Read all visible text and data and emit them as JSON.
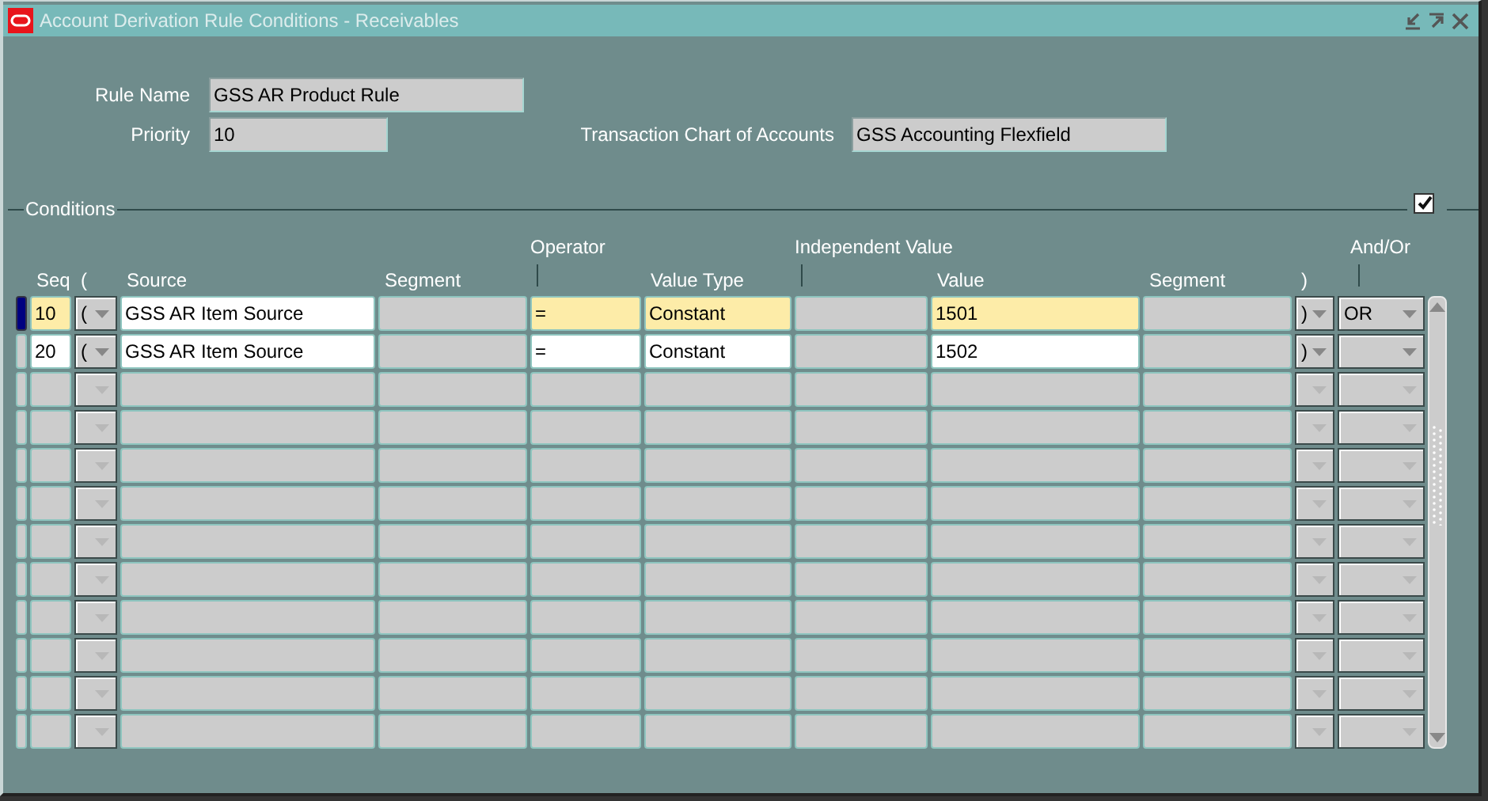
{
  "window": {
    "title": "Account Derivation Rule Conditions - Receivables"
  },
  "header": {
    "rule_name": {
      "label": "Rule Name",
      "value": "GSS AR Product Rule"
    },
    "priority": {
      "label": "Priority",
      "value": "10"
    },
    "chart": {
      "label": "Transaction Chart of Accounts",
      "value": "GSS Accounting Flexfield"
    }
  },
  "conditions": {
    "title": "Conditions",
    "checked": true,
    "group_headers": [
      "Operator",
      "Independent Value",
      "And/Or"
    ],
    "columns": [
      {
        "kind": "text",
        "label": "Seq"
      },
      {
        "kind": "text",
        "label": "("
      },
      {
        "kind": "text",
        "label": "Source"
      },
      {
        "kind": "text",
        "label": "Segment"
      },
      {
        "kind": "mark"
      },
      {
        "kind": "text",
        "label": "Value Type"
      },
      {
        "kind": "mark"
      },
      {
        "kind": "text",
        "label": "Value"
      },
      {
        "kind": "text",
        "label": "Segment"
      },
      {
        "kind": "text",
        "label": ")"
      },
      {
        "kind": "mark"
      }
    ],
    "rows": [
      {
        "kind": "record",
        "selected": true,
        "seq": {
          "value": "10",
          "highlighted": true
        },
        "open_paren": "(",
        "source": {
          "value": "GSS AR Item Source",
          "highlighted": false
        },
        "operator": {
          "value": "=",
          "highlighted": true
        },
        "value_type": {
          "value": "Constant",
          "highlighted": true
        },
        "value": {
          "value": "1501",
          "highlighted": true
        },
        "close_paren": ")",
        "and_or": "OR"
      },
      {
        "kind": "record",
        "selected": false,
        "seq": {
          "value": "20",
          "highlighted": false
        },
        "open_paren": "(",
        "source": {
          "value": "GSS AR Item Source",
          "highlighted": false
        },
        "operator": {
          "value": "=",
          "highlighted": false
        },
        "value_type": {
          "value": "Constant",
          "highlighted": false
        },
        "value": {
          "value": "1502",
          "highlighted": false
        },
        "close_paren": ")"
      },
      {
        "kind": "blank",
        "selected": false
      },
      {
        "kind": "blank",
        "selected": false
      },
      {
        "kind": "blank",
        "selected": false
      },
      {
        "kind": "blank",
        "selected": false
      },
      {
        "kind": "blank",
        "selected": false
      },
      {
        "kind": "blank",
        "selected": false
      },
      {
        "kind": "blank",
        "selected": false
      },
      {
        "kind": "blank",
        "selected": false
      },
      {
        "kind": "blank",
        "selected": false
      },
      {
        "kind": "blank",
        "selected": false
      }
    ]
  }
}
